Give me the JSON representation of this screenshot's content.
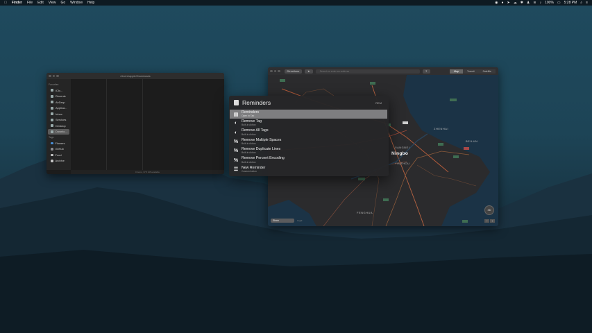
{
  "menubar": {
    "app": "Finder",
    "items": [
      "File",
      "Edit",
      "View",
      "Go",
      "Window",
      "Help"
    ],
    "battery": "100%",
    "clock": "5:28 PM"
  },
  "finder": {
    "title": "/Users/apple/Downloads",
    "sections": {
      "favorites": "Favorites",
      "tags": "Tags"
    },
    "favorites": [
      "iClo...",
      "Recents",
      "AirDrop",
      "Applica...",
      "Inbox",
      "Services",
      "Desktop",
      "Downlo..."
    ],
    "tags": [
      {
        "label": "Flowers",
        "color": "#4a90d9"
      },
      {
        "label": "GitHub",
        "color": "#8e8e93"
      },
      {
        "label": "Food",
        "color": "#c8c8c8"
      },
      {
        "label": "Archive",
        "color": "#c8c8c8"
      }
    ],
    "status": "0 items, 37.5 GB available"
  },
  "maps": {
    "directions_label": "Directions",
    "search_placeholder": "Search or enter an address",
    "modes": [
      "Map",
      "Transit",
      "Satellite"
    ],
    "labels": {
      "city": "Ningbo",
      "zhenhai": "ZHENHAI",
      "beilun": "BEILUN",
      "jiangbei": "JIANGBEI",
      "yinzhou": "YINZHOU",
      "fenghua": "FENGHUA"
    },
    "show_select": "Show",
    "legal": "Legal",
    "compass": "3D",
    "zoom_minus": "−",
    "zoom_plus": "+"
  },
  "launcher": {
    "query": "Reminders",
    "tag": "REM",
    "results": [
      {
        "title": "Reminders",
        "subtitle": "Open in Tab"
      },
      {
        "title": "Remove Tag",
        "subtitle": "Built-in Action"
      },
      {
        "title": "Remove All Tags",
        "subtitle": "Built-in Action"
      },
      {
        "title": "Remove Multiple Spaces",
        "subtitle": "Built-in Action"
      },
      {
        "title": "Remove Duplicate Lines",
        "subtitle": "Built-in Action"
      },
      {
        "title": "Remove Percent Encoding",
        "subtitle": "Built-in Action"
      },
      {
        "title": "New Reminder",
        "subtitle": "Custom Action"
      }
    ]
  }
}
